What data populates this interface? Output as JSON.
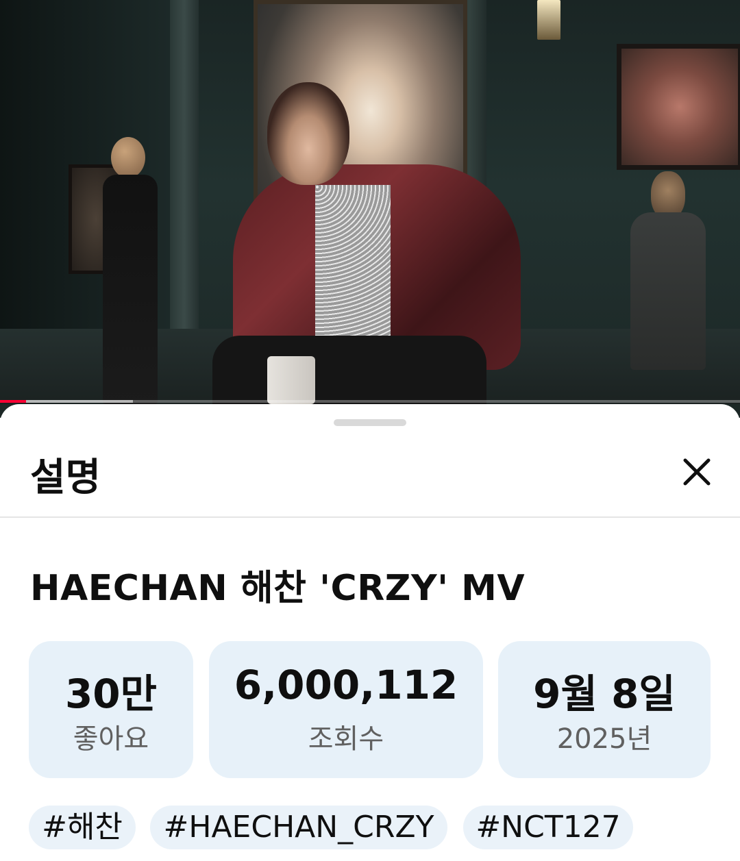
{
  "video": {
    "progress_fraction": 0.035,
    "buffer_fraction": 0.18
  },
  "sheet": {
    "title": "설명",
    "close_icon": "close-icon"
  },
  "description": {
    "video_title": "HAECHAN 해찬 'CRZY' MV",
    "stats": [
      {
        "value": "30만",
        "label": "좋아요"
      },
      {
        "value": "6,000,112",
        "label": "조회수"
      },
      {
        "value": "9월 8일",
        "label": "2025년"
      }
    ],
    "tags": [
      "#해찬",
      "#HAECHAN_CRZY",
      "#NCT127"
    ]
  },
  "colors": {
    "progress": "#ff0033",
    "stat_background": "#e7f1f9",
    "tag_background": "#eaf2f9"
  }
}
